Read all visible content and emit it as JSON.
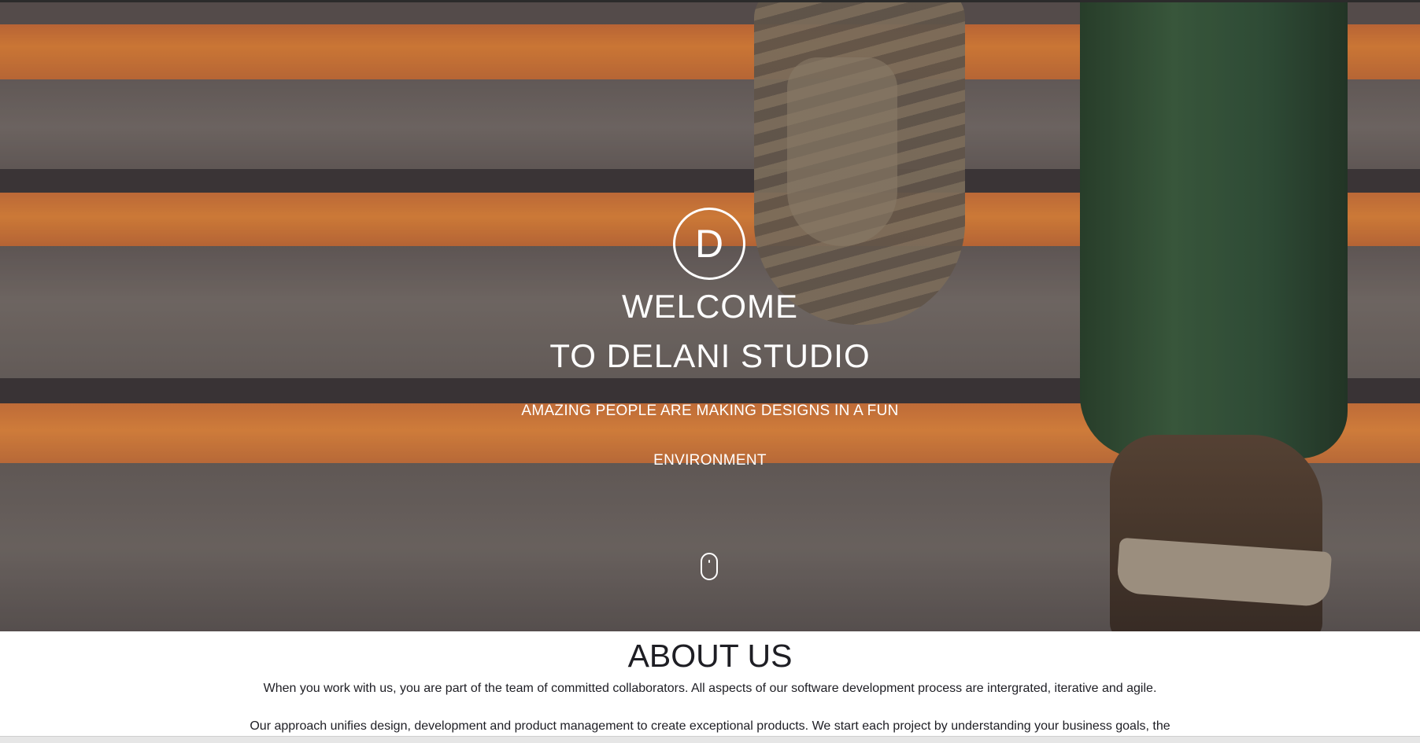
{
  "hero": {
    "logo_letter": "D",
    "welcome_line1": "WELCOME",
    "welcome_line2": "TO DELANI STUDIO",
    "tagline_line1": "AMAZING PEOPLE ARE MAKING DESIGNS IN A FUN",
    "tagline_line2": "ENVIRONMENT",
    "scroll_icon": "mouse-scroll-icon",
    "background_image": "stairs-with-shoe"
  },
  "about": {
    "title": "ABOUT US",
    "paragraph1": "When you work with us, you are part of the team of committed collaborators. All aspects of our software development process are intergrated, iterative and agile.",
    "paragraph2": "Our approach unifies design, development and product management to create exceptional products. We start each project by understanding your business goals, the"
  },
  "colors": {
    "accent_orange": "#f08e3c",
    "hero_text": "#ffffff",
    "body_text": "#1e1e24"
  }
}
